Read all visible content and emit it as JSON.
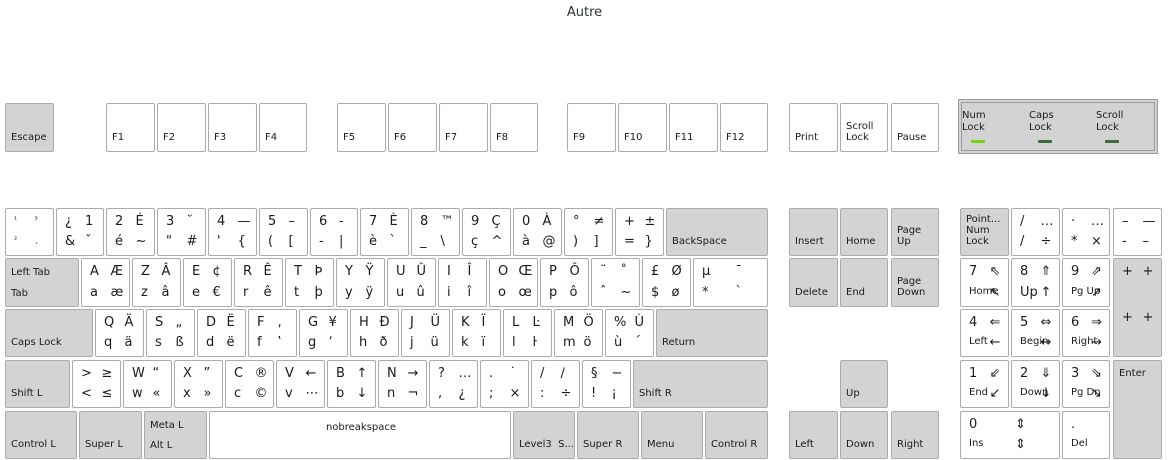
{
  "title": "Autre",
  "leds": [
    {
      "label": "Num\nLock",
      "name": "num-lock-led",
      "color": "#73d216"
    },
    {
      "label": "Caps\nLock",
      "name": "caps-lock-led",
      "color": "#3f6a3c"
    },
    {
      "label": "Scroll\nLock",
      "name": "scroll-lock-led",
      "color": "#3f6a3c"
    }
  ],
  "keys": [
    {
      "id": "escape",
      "label": "Escape"
    },
    {
      "id": "f1",
      "label": "F1"
    },
    {
      "id": "f2",
      "label": "F2"
    },
    {
      "id": "f3",
      "label": "F3"
    },
    {
      "id": "f4",
      "label": "F4"
    },
    {
      "id": "f5",
      "label": "F5"
    },
    {
      "id": "f6",
      "label": "F6"
    },
    {
      "id": "f7",
      "label": "F7"
    },
    {
      "id": "f8",
      "label": "F8"
    },
    {
      "id": "f9",
      "label": "F9"
    },
    {
      "id": "f10",
      "label": "F10"
    },
    {
      "id": "f11",
      "label": "F11"
    },
    {
      "id": "f12",
      "label": "F12"
    },
    {
      "id": "print",
      "label": "Print"
    },
    {
      "id": "scroll",
      "label": "Scroll\nLock"
    },
    {
      "id": "pause",
      "label": "Pause"
    },
    {
      "id": "k-grave",
      "g": [
        "¹",
        "³",
        "²",
        "¸"
      ],
      "small": true
    },
    {
      "id": "k1",
      "g": [
        "¿",
        "1",
        "&",
        "ˇ"
      ]
    },
    {
      "id": "k2",
      "g": [
        "2",
        "É",
        "é",
        "~"
      ]
    },
    {
      "id": "k3",
      "g": [
        "3",
        "˘",
        "\"",
        "#"
      ]
    },
    {
      "id": "k4",
      "g": [
        "4",
        "—",
        "'",
        "{"
      ]
    },
    {
      "id": "k5",
      "g": [
        "5",
        "–",
        "(",
        "["
      ]
    },
    {
      "id": "k6",
      "g": [
        "6",
        "‑",
        "-",
        "|"
      ]
    },
    {
      "id": "k7",
      "g": [
        "7",
        "È",
        "è",
        "`"
      ]
    },
    {
      "id": "k8",
      "g": [
        "8",
        "™",
        "_",
        "\\"
      ]
    },
    {
      "id": "k9",
      "g": [
        "9",
        "Ç",
        "ç",
        "^"
      ]
    },
    {
      "id": "k0",
      "g": [
        "0",
        "À",
        "à",
        "@"
      ]
    },
    {
      "id": "kminus",
      "g": [
        "°",
        "≠",
        ")",
        "]"
      ]
    },
    {
      "id": "kequal",
      "g": [
        "+",
        "±",
        "=",
        "}"
      ]
    },
    {
      "id": "backspace",
      "label": "BackSpace"
    },
    {
      "id": "insert",
      "label": "Insert"
    },
    {
      "id": "home",
      "label": "Home"
    },
    {
      "id": "pageup",
      "label": "Page\nUp"
    },
    {
      "id": "numlock",
      "label": "Point...\nNum\nLock"
    },
    {
      "id": "kpdiv",
      "g": [
        "/",
        "…",
        "/",
        "÷"
      ]
    },
    {
      "id": "kpmul",
      "g": [
        "·",
        "…",
        "*",
        "×"
      ]
    },
    {
      "id": "kpsub",
      "g": [
        "–",
        "—",
        "-",
        "–"
      ]
    },
    {
      "id": "tab",
      "label": "Left Tab",
      "label2": "Tab"
    },
    {
      "id": "ka",
      "g": [
        "A",
        "Æ",
        "a",
        "æ"
      ]
    },
    {
      "id": "kz",
      "g": [
        "Z",
        "Â",
        "z",
        "â"
      ]
    },
    {
      "id": "ke",
      "g": [
        "E",
        "¢",
        "e",
        "€"
      ]
    },
    {
      "id": "kr",
      "g": [
        "R",
        "Ê",
        "r",
        "ê"
      ]
    },
    {
      "id": "kt",
      "g": [
        "T",
        "Þ",
        "t",
        "þ"
      ]
    },
    {
      "id": "ky",
      "g": [
        "Y",
        "Ÿ",
        "y",
        "ÿ"
      ]
    },
    {
      "id": "ku",
      "g": [
        "U",
        "Û",
        "u",
        "û"
      ]
    },
    {
      "id": "ki",
      "g": [
        "I",
        "Î",
        "i",
        "î"
      ]
    },
    {
      "id": "ko",
      "g": [
        "O",
        "Œ",
        "o",
        "œ"
      ]
    },
    {
      "id": "kp",
      "g": [
        "P",
        "Ô",
        "p",
        "ô"
      ]
    },
    {
      "id": "kbracketl",
      "g": [
        "¨",
        "˚",
        "ˆ",
        "~"
      ]
    },
    {
      "id": "kbracketr",
      "g": [
        "£",
        "Ø",
        "$",
        "ø"
      ]
    },
    {
      "id": "kreturn2",
      "g": [
        "µ",
        "¯",
        "*",
        "`"
      ]
    },
    {
      "id": "delete",
      "label": "Delete"
    },
    {
      "id": "end",
      "label": "End"
    },
    {
      "id": "pagedown",
      "label": "Page\nDown"
    },
    {
      "id": "kp7",
      "g": [
        "7",
        "⇖",
        "Home",
        "↖"
      ]
    },
    {
      "id": "kp8",
      "g": [
        "8",
        "⇑",
        "Up",
        "↑"
      ]
    },
    {
      "id": "kp9",
      "g": [
        "9",
        "⇗",
        "Pg Up",
        "↗"
      ]
    },
    {
      "id": "kpadd",
      "g": [
        "+",
        "+",
        "+",
        "+"
      ]
    },
    {
      "id": "caps",
      "label": "Caps Lock"
    },
    {
      "id": "kq",
      "g": [
        "Q",
        "Ä",
        "q",
        "ä"
      ]
    },
    {
      "id": "ks",
      "g": [
        "S",
        "„",
        "s",
        "ß"
      ]
    },
    {
      "id": "kd",
      "g": [
        "D",
        "Ë",
        "d",
        "ë"
      ]
    },
    {
      "id": "kf",
      "g": [
        "F",
        "‚",
        "f",
        "‛"
      ]
    },
    {
      "id": "kg",
      "g": [
        "G",
        "¥",
        "g",
        "ʼ"
      ]
    },
    {
      "id": "kh",
      "g": [
        "H",
        "Ð",
        "h",
        "ð"
      ]
    },
    {
      "id": "kj",
      "g": [
        "J",
        "Ü",
        "j",
        "ü"
      ]
    },
    {
      "id": "kk",
      "g": [
        "K",
        "Ï",
        "k",
        "ï"
      ]
    },
    {
      "id": "kl",
      "g": [
        "L",
        "Ŀ",
        "l",
        "ŀ"
      ]
    },
    {
      "id": "km",
      "g": [
        "M",
        "Ö",
        "m",
        "ö"
      ]
    },
    {
      "id": "kquote",
      "g": [
        "%",
        "Ù",
        "ù",
        "´"
      ]
    },
    {
      "id": "return",
      "label": "Return"
    },
    {
      "id": "kp4",
      "g": [
        "4",
        "⇐",
        "Left",
        "←"
      ]
    },
    {
      "id": "kp5",
      "g": [
        "5",
        "⇔",
        "Begin",
        "↔"
      ]
    },
    {
      "id": "kp6",
      "g": [
        "6",
        "⇒",
        "Right",
        "→"
      ]
    },
    {
      "id": "shiftl",
      "label": "Shift L"
    },
    {
      "id": "kless",
      "g": [
        ">",
        "≥",
        "<",
        "≤"
      ]
    },
    {
      "id": "kw",
      "g": [
        "W",
        "“",
        "w",
        "«"
      ]
    },
    {
      "id": "kx",
      "g": [
        "X",
        "”",
        "x",
        "»"
      ]
    },
    {
      "id": "kc",
      "g": [
        "C",
        "®",
        "c",
        "©"
      ]
    },
    {
      "id": "kv",
      "g": [
        "V",
        "←",
        "v",
        "⋯"
      ]
    },
    {
      "id": "kb",
      "g": [
        "B",
        "↑",
        "b",
        "↓"
      ]
    },
    {
      "id": "kn",
      "g": [
        "N",
        "→",
        "n",
        "¬"
      ]
    },
    {
      "id": "kcomma",
      "g": [
        "?",
        "…",
        ",",
        "¿"
      ]
    },
    {
      "id": "ksemi",
      "g": [
        ".",
        "˙",
        ";",
        "×"
      ]
    },
    {
      "id": "kcolon",
      "g": [
        "/",
        "∕",
        ":",
        "÷"
      ]
    },
    {
      "id": "kexcl",
      "g": [
        "§",
        "−",
        "!",
        "¡"
      ]
    },
    {
      "id": "shiftr",
      "label": "Shift R"
    },
    {
      "id": "up",
      "label": "Up"
    },
    {
      "id": "kp1",
      "g": [
        "1",
        "⇙",
        "End",
        "↙"
      ]
    },
    {
      "id": "kp2",
      "g": [
        "2",
        "⇓",
        "Down",
        "↓"
      ]
    },
    {
      "id": "kp3",
      "g": [
        "3",
        "⇘",
        "Pg Dn",
        "↘"
      ]
    },
    {
      "id": "kpenter",
      "label": "Enter"
    },
    {
      "id": "ctrll",
      "label": "Control L"
    },
    {
      "id": "superl",
      "label": "Super L"
    },
    {
      "id": "altl",
      "label": "Meta L",
      "label2": "Alt L"
    },
    {
      "id": "space",
      "label": "nobreakspace"
    },
    {
      "id": "level3",
      "label": "Level3  S..."
    },
    {
      "id": "superr",
      "label": "Super R"
    },
    {
      "id": "menu",
      "label": "Menu"
    },
    {
      "id": "ctrlr",
      "label": "Control R"
    },
    {
      "id": "left",
      "label": "Left"
    },
    {
      "id": "down",
      "label": "Down"
    },
    {
      "id": "right",
      "label": "Right"
    },
    {
      "id": "kp0",
      "g": [
        "0",
        "⇕",
        "Ins",
        "⇕"
      ]
    },
    {
      "id": "kpdec",
      "g": [
        ".",
        "",
        "Del",
        ""
      ]
    }
  ]
}
